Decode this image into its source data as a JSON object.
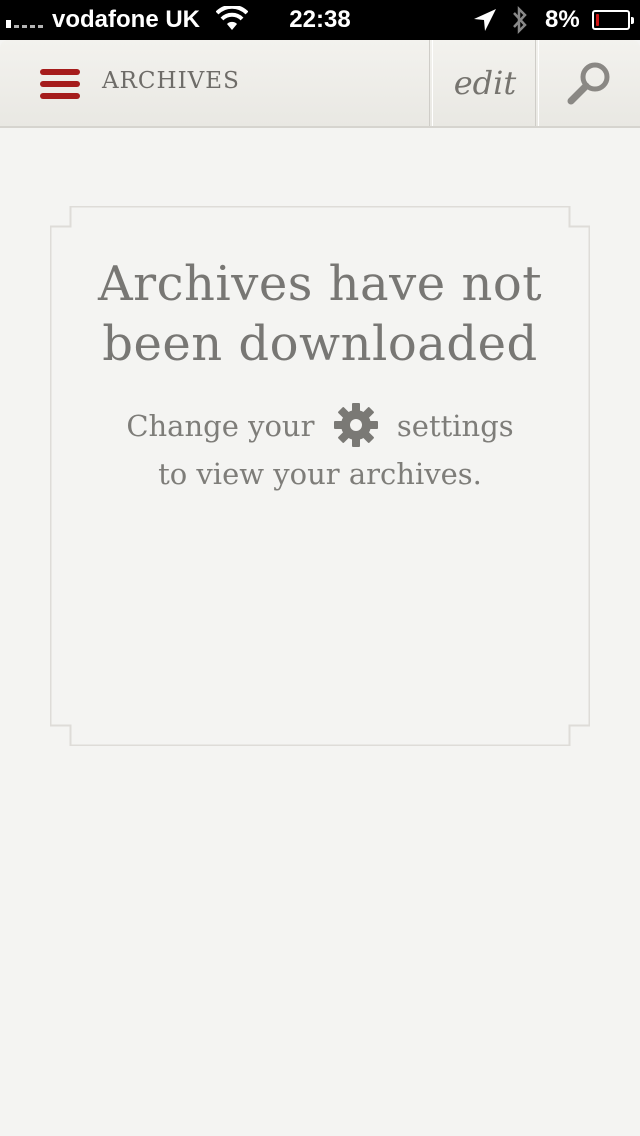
{
  "status_bar": {
    "carrier": "vodafone UK",
    "time": "22:38",
    "battery_percent": "8%",
    "battery_level": 0.08
  },
  "navbar": {
    "title": "ARCHIVES",
    "edit_label": "edit",
    "menu_icon": "hamburger-menu-icon",
    "search_icon": "magnifier-icon",
    "accent_color": "#a51c1c"
  },
  "empty_state": {
    "heading_line1": "Archives have not",
    "heading_line2": "been downloaded",
    "body_before_icon": "Change your",
    "body_after_icon": "settings",
    "body_line2": "to view your archives.",
    "inline_icon": "gear-icon"
  }
}
